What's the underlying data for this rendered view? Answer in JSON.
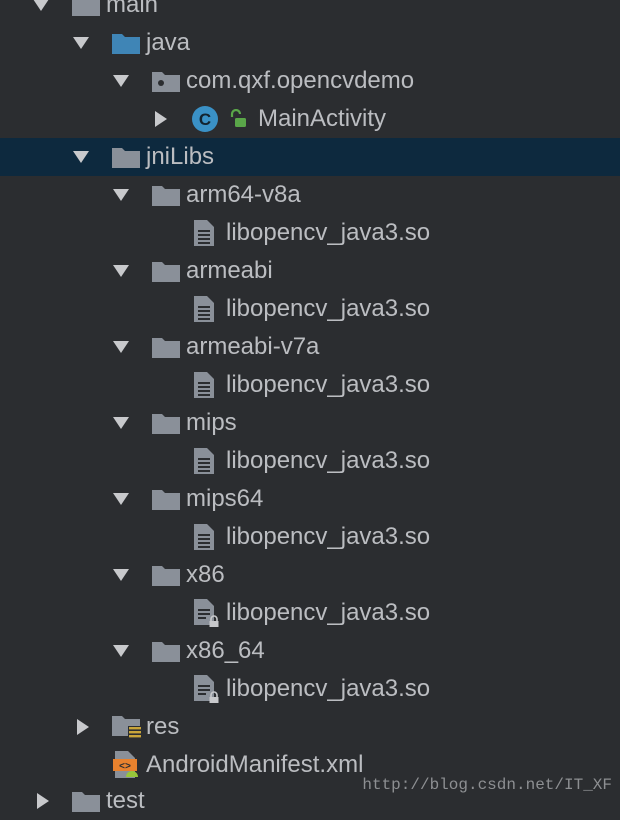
{
  "tree": {
    "main": "main",
    "java": "java",
    "package": "com.qxf.opencvdemo",
    "class_badge": "C",
    "main_activity": "MainActivity",
    "jnilibs": "jniLibs",
    "folders": [
      "arm64-v8a",
      "armeabi",
      "armeabi-v7a",
      "mips",
      "mips64",
      "x86",
      "x86_64"
    ],
    "so_file": "libopencv_java3.so",
    "res": "res",
    "manifest": "AndroidManifest.xml",
    "test": "test"
  },
  "watermark": "http://blog.csdn.net/IT_XF",
  "colors": {
    "background": "#2b2d30",
    "selection": "#0d293e",
    "folder": "#8a9099",
    "source_folder": "#3f85b6",
    "class_badge": "#3a91c6",
    "text": "#bbbdc1"
  }
}
